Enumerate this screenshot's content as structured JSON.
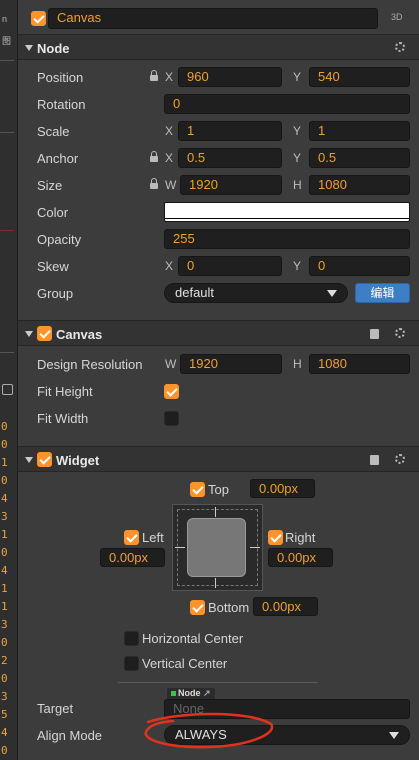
{
  "node_name": "Canvas",
  "mode_label": "3D",
  "left_strip": {
    "top_chars": [
      "n",
      "图"
    ],
    "yellow_chars": [
      "0",
      "0",
      "1",
      "0",
      "4",
      "3",
      "1",
      "0",
      "4",
      "1",
      "1",
      "3",
      "0",
      "2",
      "0",
      "3",
      "5",
      "4",
      "0"
    ]
  },
  "node_section": {
    "title": "Node",
    "position": {
      "label": "Position",
      "x_axis": "X",
      "x": "960",
      "y_axis": "Y",
      "y": "540"
    },
    "rotation": {
      "label": "Rotation",
      "value": "0"
    },
    "scale": {
      "label": "Scale",
      "x_axis": "X",
      "x": "1",
      "y_axis": "Y",
      "y": "1"
    },
    "anchor": {
      "label": "Anchor",
      "x_axis": "X",
      "x": "0.5",
      "y_axis": "Y",
      "y": "0.5"
    },
    "size": {
      "label": "Size",
      "w_axis": "W",
      "w": "1920",
      "h_axis": "H",
      "h": "1080"
    },
    "color": {
      "label": "Color",
      "value": "#ffffff"
    },
    "opacity": {
      "label": "Opacity",
      "value": "255"
    },
    "skew": {
      "label": "Skew",
      "x_axis": "X",
      "x": "0",
      "y_axis": "Y",
      "y": "0"
    },
    "group": {
      "label": "Group",
      "value": "default",
      "edit_label": "编辑"
    }
  },
  "canvas_section": {
    "title": "Canvas",
    "design_resolution": {
      "label": "Design Resolution",
      "w_axis": "W",
      "w": "1920",
      "h_axis": "H",
      "h": "1080"
    },
    "fit_height": {
      "label": "Fit Height",
      "checked": true
    },
    "fit_width": {
      "label": "Fit Width",
      "checked": false
    }
  },
  "widget_section": {
    "title": "Widget",
    "top": {
      "label": "Top",
      "value": "0.00px",
      "checked": true
    },
    "left": {
      "label": "Left",
      "value": "0.00px",
      "checked": true
    },
    "right": {
      "label": "Right",
      "value": "0.00px",
      "checked": true
    },
    "bottom": {
      "label": "Bottom",
      "value": "0.00px",
      "checked": true
    },
    "horizontal_center": {
      "label": "Horizontal Center",
      "checked": false
    },
    "vertical_center": {
      "label": "Vertical Center",
      "checked": false
    },
    "target": {
      "label": "Target",
      "badge": "Node",
      "placeholder": "None"
    },
    "align_mode": {
      "label": "Align Mode",
      "value": "ALWAYS"
    }
  },
  "colors": {
    "accent": "#fd942b",
    "field_text": "#f0a030",
    "edit_button": "#3c7fc7",
    "annotation": "#e0321e"
  }
}
